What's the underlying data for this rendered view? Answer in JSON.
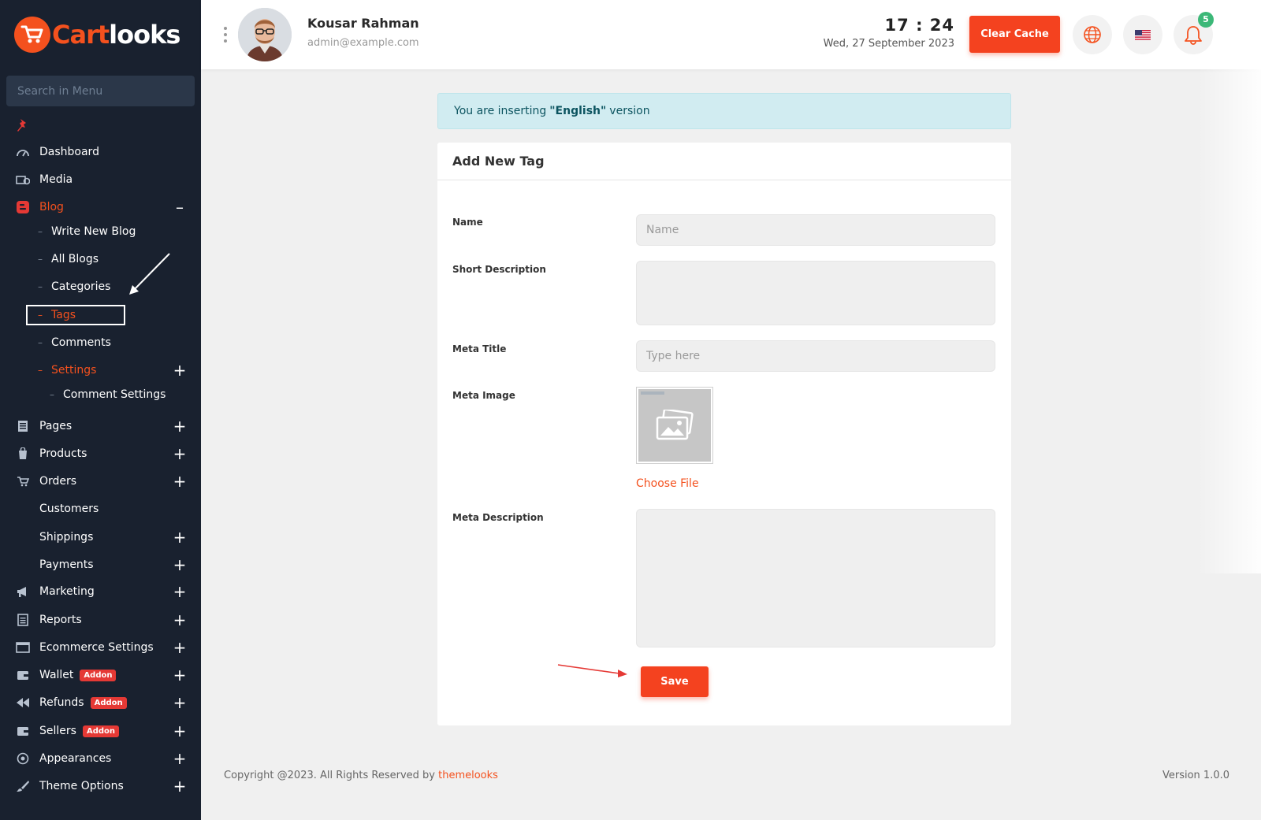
{
  "brand": {
    "part1": "Cart",
    "part2": "looks",
    "accent": "#f4511e",
    "sidebar_bg": "#19212f"
  },
  "sidebar": {
    "search_placeholder": "Search in Menu",
    "items": [
      {
        "label": "Dashboard",
        "icon": "gauge-icon"
      },
      {
        "label": "Media",
        "icon": "media-icon"
      },
      {
        "label": "Blog",
        "icon": "blog-icon",
        "active": true,
        "toggle": "–"
      },
      {
        "label": "Write New Blog"
      },
      {
        "label": "All Blogs"
      },
      {
        "label": "Categories"
      },
      {
        "label": "Tags",
        "active": true
      },
      {
        "label": "Comments"
      },
      {
        "label": "Settings",
        "active": true,
        "toggle": "+"
      },
      {
        "label": "Comment Settings"
      },
      {
        "label": "Pages",
        "icon": "pages-icon",
        "toggle": "+"
      },
      {
        "label": "Products",
        "icon": "products-icon",
        "toggle": "+"
      },
      {
        "label": "Orders",
        "icon": "cart-icon",
        "toggle": "+"
      },
      {
        "label": "Customers"
      },
      {
        "label": "Shippings",
        "toggle": "+"
      },
      {
        "label": "Payments",
        "toggle": "+"
      },
      {
        "label": "Marketing",
        "icon": "megaphone-icon",
        "toggle": "+"
      },
      {
        "label": "Reports",
        "icon": "reports-icon",
        "toggle": "+"
      },
      {
        "label": "Ecommerce Settings",
        "icon": "window-icon",
        "toggle": "+"
      },
      {
        "label": "Wallet",
        "icon": "wallet-icon",
        "badge": "Addon",
        "toggle": "+"
      },
      {
        "label": "Refunds",
        "icon": "rewind-icon",
        "badge": "Addon",
        "toggle": "+"
      },
      {
        "label": "Sellers",
        "icon": "wallet-icon",
        "badge": "Addon",
        "toggle": "+"
      },
      {
        "label": "Appearances",
        "icon": "palette-icon",
        "toggle": "+"
      },
      {
        "label": "Theme Options",
        "icon": "brush-icon",
        "toggle": "+"
      }
    ]
  },
  "header": {
    "user_name": "Kousar Rahman",
    "user_email": "admin@example.com",
    "time": "17 : 24",
    "date": "Wed, 27 September 2023",
    "clear_cache": "Clear Cache",
    "notification_count": "5"
  },
  "notice": {
    "prefix": "You are inserting",
    "language": "\"English\"",
    "suffix": "version"
  },
  "form": {
    "title": "Add New Tag",
    "name_label": "Name",
    "name_placeholder": "Name",
    "short_desc_label": "Short Description",
    "meta_title_label": "Meta Title",
    "meta_title_placeholder": "Type here",
    "meta_image_label": "Meta Image",
    "choose_file": "Choose File",
    "meta_desc_label": "Meta Description",
    "save": "Save"
  },
  "footer": {
    "copyright": "Copyright @2023. All Rights Reserved by",
    "link": "themelooks",
    "version": "Version 1.0.0"
  }
}
